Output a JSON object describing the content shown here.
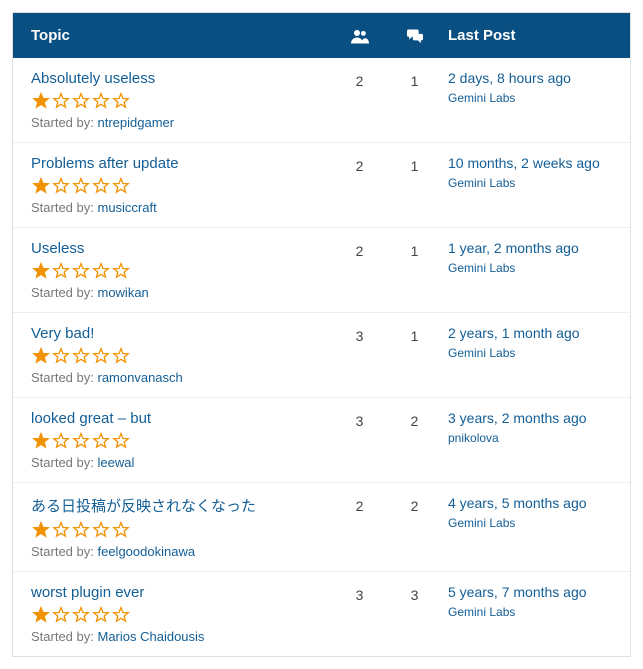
{
  "header": {
    "topic": "Topic",
    "lastPost": "Last Post"
  },
  "labels": {
    "startedBy": "Started by: "
  },
  "rating": {
    "filled": 1,
    "total": 5
  },
  "topics": [
    {
      "title": "Absolutely useless",
      "author": "ntrepidgamer",
      "voices": "2",
      "replies": "1",
      "lastTime": "2 days, 8 hours ago",
      "lastAuthor": "Gemini Labs"
    },
    {
      "title": "Problems after update",
      "author": "musiccraft",
      "voices": "2",
      "replies": "1",
      "lastTime": "10 months, 2 weeks ago",
      "lastAuthor": "Gemini Labs"
    },
    {
      "title": "Useless",
      "author": "mowikan",
      "voices": "2",
      "replies": "1",
      "lastTime": "1 year, 2 months ago",
      "lastAuthor": "Gemini Labs"
    },
    {
      "title": "Very bad!",
      "author": "ramonvanasch",
      "voices": "3",
      "replies": "1",
      "lastTime": "2 years, 1 month ago",
      "lastAuthor": "Gemini Labs"
    },
    {
      "title": "looked great – but",
      "author": "leewal",
      "voices": "3",
      "replies": "2",
      "lastTime": "3 years, 2 months ago",
      "lastAuthor": "pnikolova"
    },
    {
      "title": "ある日投稿が反映されなくなった",
      "author": "feelgoodokinawa",
      "voices": "2",
      "replies": "2",
      "lastTime": "4 years, 5 months ago",
      "lastAuthor": "Gemini Labs"
    },
    {
      "title": "worst plugin ever",
      "author": "Marios Chaidousis",
      "voices": "3",
      "replies": "3",
      "lastTime": "5 years, 7 months ago",
      "lastAuthor": "Gemini Labs"
    }
  ]
}
